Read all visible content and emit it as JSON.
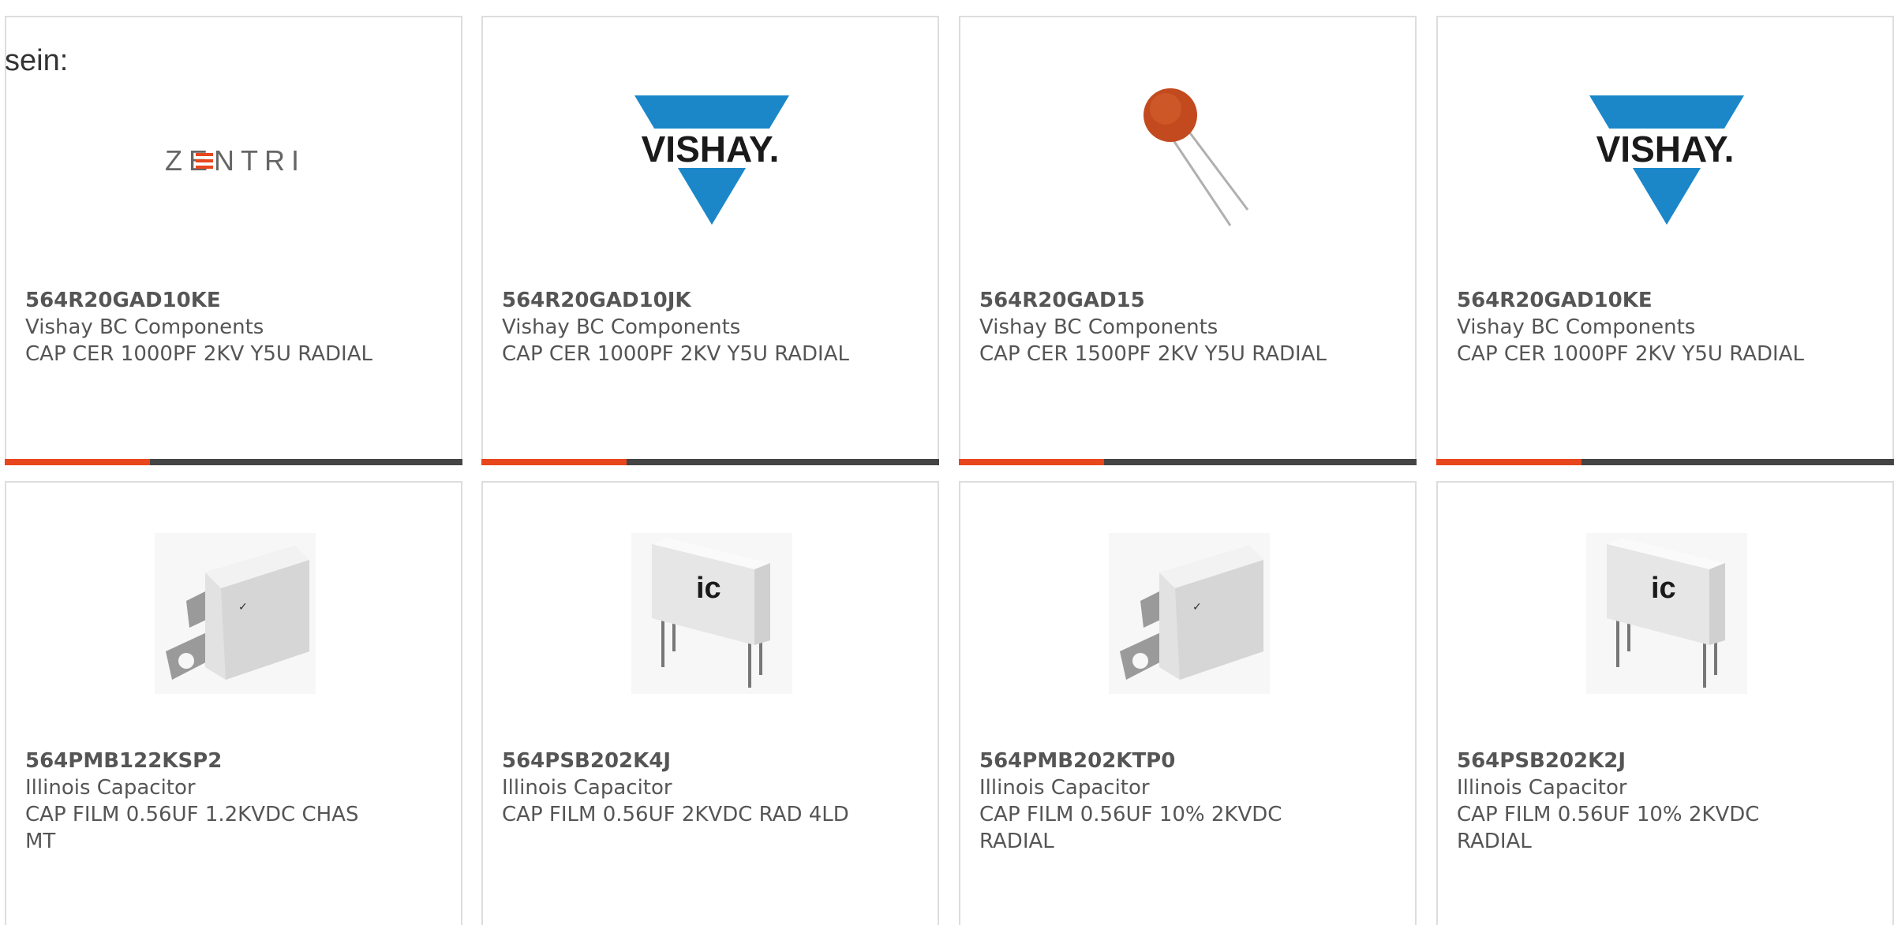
{
  "intro_text": "sein:",
  "brand_colors": {
    "accent": "#e8461c",
    "bar": "#444444",
    "vishay_blue": "#1b87c9"
  },
  "products": [
    {
      "part_number": "564R20GAD10KE",
      "manufacturer": "Vishay BC Components",
      "description": "CAP CER 1000PF 2KV Y5U RADIAL",
      "image": "zentri-logo",
      "logo_text": "ZENTRI"
    },
    {
      "part_number": "564R20GAD10JK",
      "manufacturer": "Vishay BC Components",
      "description": "CAP CER 1000PF 2KV Y5U RADIAL",
      "image": "vishay-logo",
      "logo_text": "VISHAY."
    },
    {
      "part_number": "564R20GAD15",
      "manufacturer": "Vishay BC Components",
      "description": "CAP CER 1500PF 2KV Y5U RADIAL",
      "image": "ceramic-disc-capacitor"
    },
    {
      "part_number": "564R20GAD10KE",
      "manufacturer": "Vishay BC Components",
      "description": "CAP CER 1000PF 2KV Y5U RADIAL",
      "image": "vishay-logo",
      "logo_text": "VISHAY."
    },
    {
      "part_number": "564PMB122KSP2",
      "manufacturer": "Illinois Capacitor",
      "description": "CAP FILM 0.56UF 1.2KVDC CHAS MT",
      "image": "chassis-mount-film-capacitor"
    },
    {
      "part_number": "564PSB202K4J",
      "manufacturer": "Illinois Capacitor",
      "description": "CAP FILM 0.56UF 2KVDC RAD 4LD",
      "image": "radial-film-capacitor",
      "logo_text": "ic"
    },
    {
      "part_number": "564PMB202KTP0",
      "manufacturer": "Illinois Capacitor",
      "description": "CAP FILM 0.56UF 10% 2KVDC RADIAL",
      "image": "chassis-mount-film-capacitor"
    },
    {
      "part_number": "564PSB202K2J",
      "manufacturer": "Illinois Capacitor",
      "description": "CAP FILM 0.56UF 10% 2KVDC RADIAL",
      "image": "radial-film-capacitor",
      "logo_text": "ic"
    }
  ]
}
